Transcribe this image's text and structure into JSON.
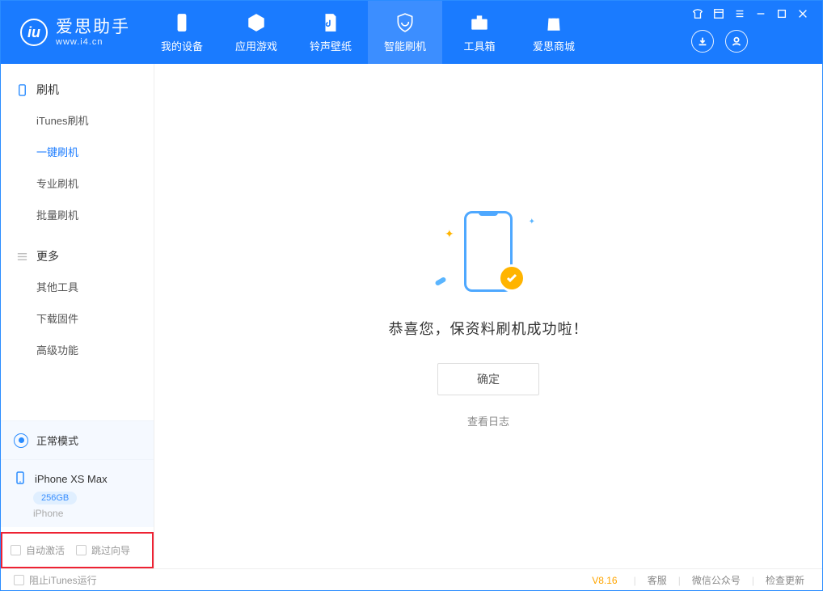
{
  "header": {
    "logo_title": "爱思助手",
    "logo_sub": "www.i4.cn",
    "tabs": [
      {
        "label": "我的设备"
      },
      {
        "label": "应用游戏"
      },
      {
        "label": "铃声壁纸"
      },
      {
        "label": "智能刷机"
      },
      {
        "label": "工具箱"
      },
      {
        "label": "爱思商城"
      }
    ]
  },
  "sidebar": {
    "section1_title": "刷机",
    "section1_items": [
      "iTunes刷机",
      "一键刷机",
      "专业刷机",
      "批量刷机"
    ],
    "section2_title": "更多",
    "section2_items": [
      "其他工具",
      "下载固件",
      "高级功能"
    ],
    "status_label": "正常模式",
    "device_name": "iPhone XS Max",
    "device_storage": "256GB",
    "device_type": "iPhone",
    "check1": "自动激活",
    "check2": "跳过向导"
  },
  "main": {
    "success_msg": "恭喜您，保资料刷机成功啦！",
    "ok_button": "确定",
    "view_log": "查看日志"
  },
  "footer": {
    "block_itunes": "阻止iTunes运行",
    "version": "V8.16",
    "link1": "客服",
    "link2": "微信公众号",
    "link3": "检查更新"
  }
}
